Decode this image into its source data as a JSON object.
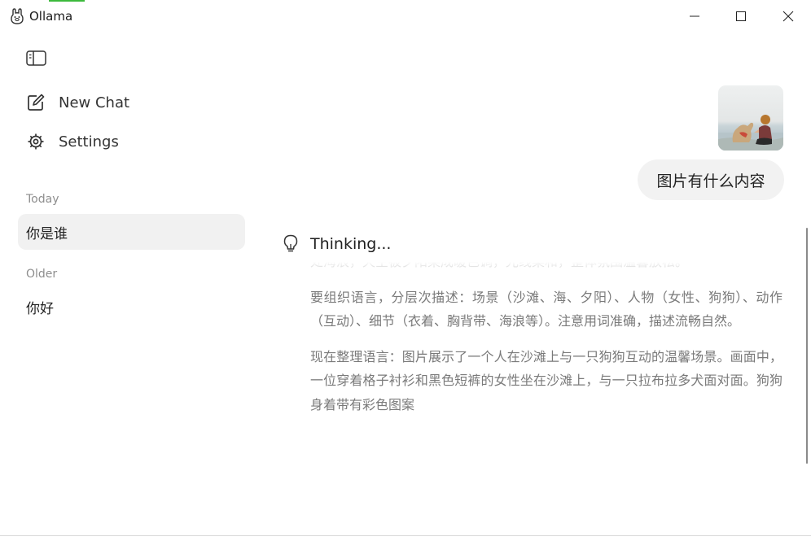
{
  "window": {
    "title": "Ollama",
    "controls": {
      "minimize": "minimize",
      "maximize": "maximize",
      "close": "close"
    }
  },
  "sidebar": {
    "toggle_icon": "sidebar-toggle-icon",
    "nav": [
      {
        "label": "New Chat",
        "icon": "new-chat-icon"
      },
      {
        "label": "Settings",
        "icon": "gear-icon"
      }
    ],
    "sections": [
      {
        "label": "Today",
        "chats": [
          {
            "title": "你是谁",
            "active": true
          }
        ]
      },
      {
        "label": "Older",
        "chats": [
          {
            "title": "你好",
            "active": false
          }
        ]
      }
    ]
  },
  "conversation": {
    "user_message": {
      "image": "beach-dog-photo",
      "text": "图片有什么内容"
    },
    "thinking": {
      "label": "Thinking...",
      "paragraphs": [
        "处海浪，天空被夕阳染成暖色调，光线柔和，整体氛围温馨放松。",
        "要组织语言，分层次描述：场景（沙滩、海、夕阳）、人物（女性、狗狗）、动作（互动）、细节（衣着、胸背带、海浪等）。注意用词准确，描述流畅自然。",
        "现在整理语言：图片展示了一个人在沙滩上与一只狗狗互动的温馨场景。画面中，一位穿着格子衬衫和黑色短裤的女性坐在沙滩上，与一只拉布拉多犬面对面。狗狗身着带有彩色图案"
      ]
    }
  },
  "colors": {
    "accent_green": "#3cb93c",
    "bubble_bg": "#f2f2f2",
    "active_chat_bg": "#f1f1f1",
    "thinking_text": "#7a7a7a"
  }
}
